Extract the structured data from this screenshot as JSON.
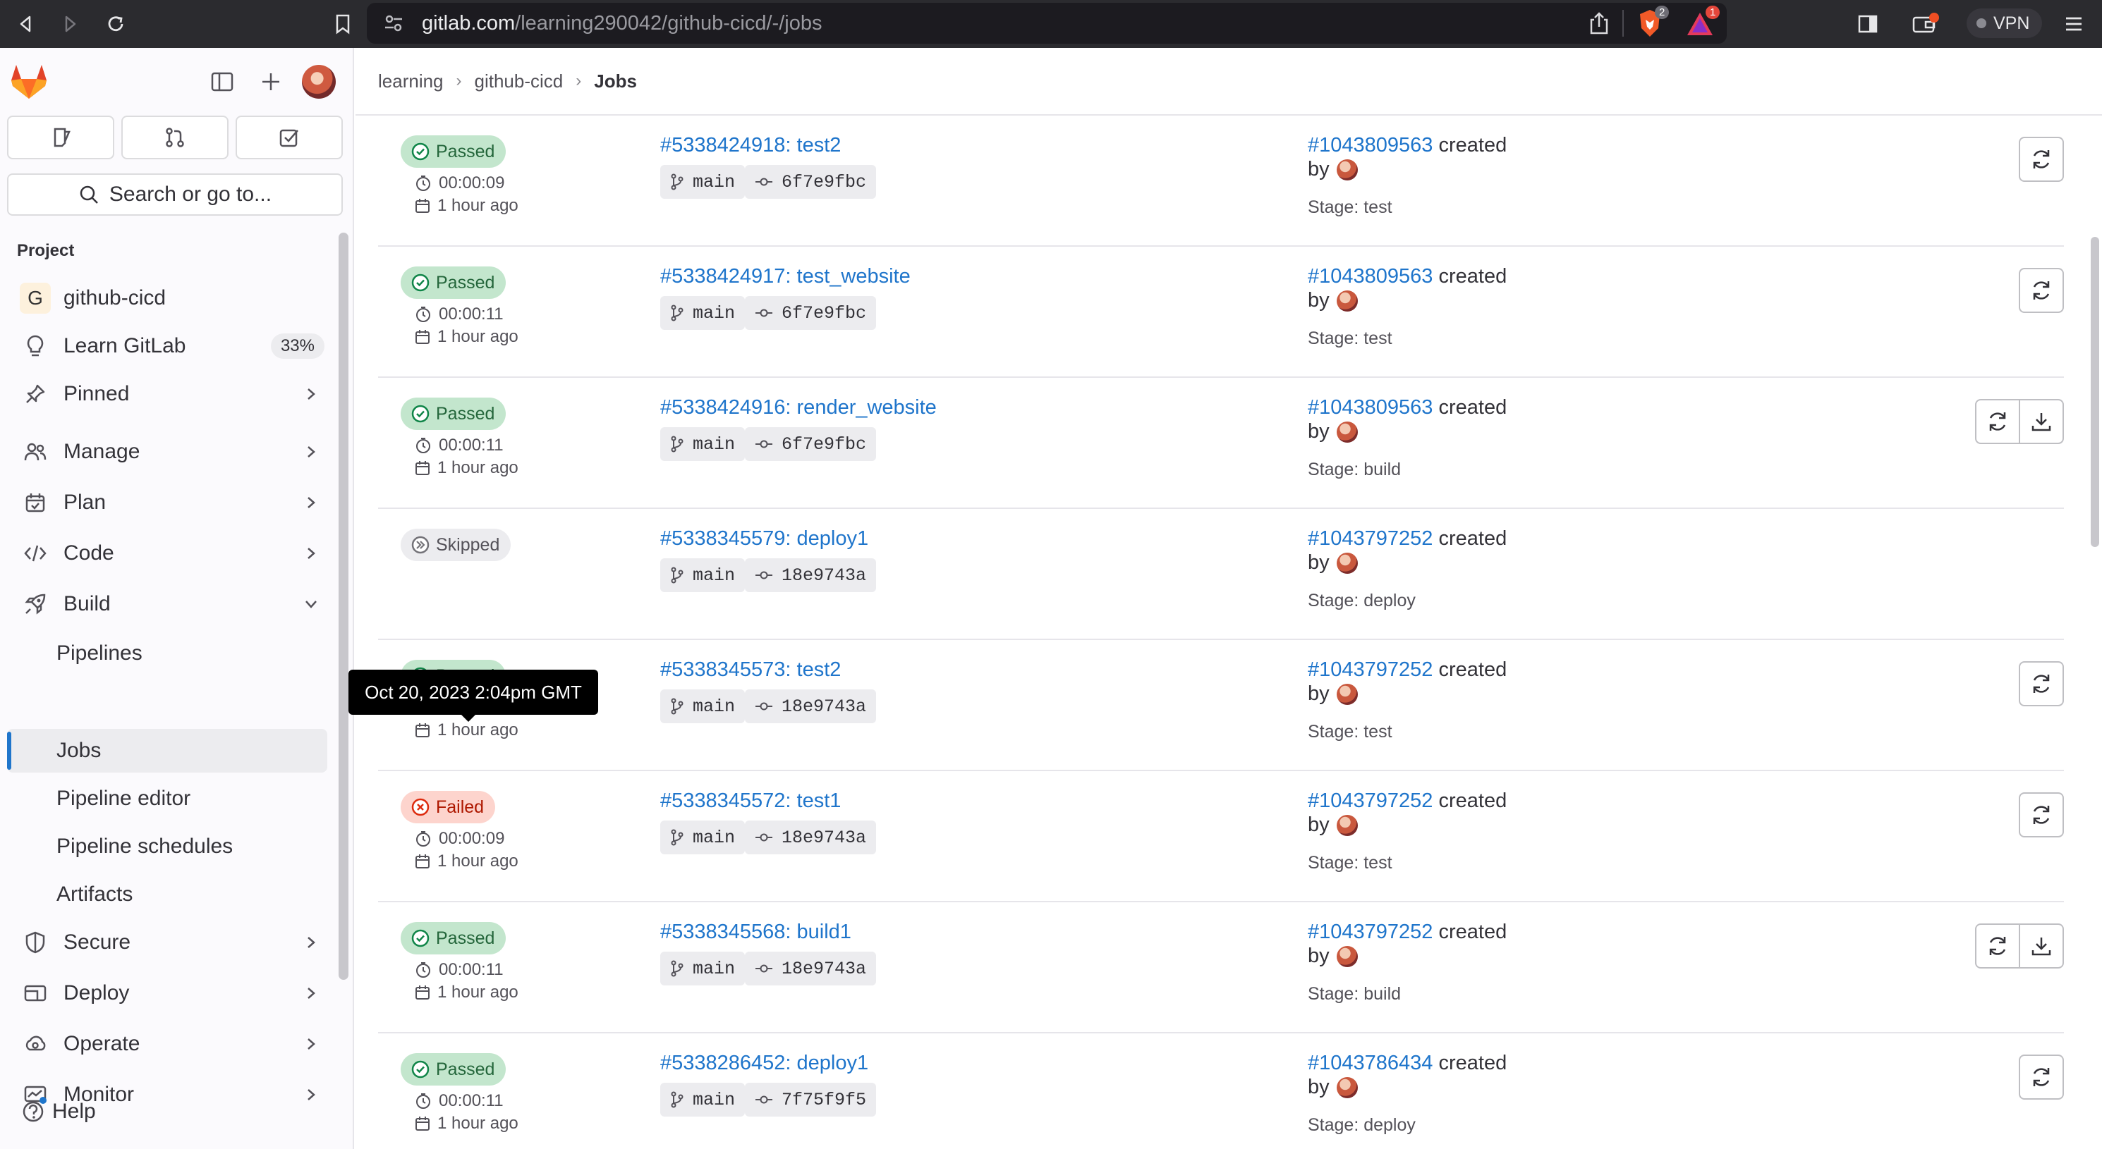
{
  "browser": {
    "url_host": "gitlab.com",
    "url_path": "/learning290042/github-cicd/-/jobs",
    "brave_badge": "2",
    "alert_badge": "1",
    "vpn_label": "VPN"
  },
  "sidebar": {
    "search_label": "Search or go to...",
    "section_title": "Project",
    "project_name": "github-cicd",
    "project_initial": "G",
    "items": [
      {
        "label": "Learn GitLab",
        "badge": "33%"
      },
      {
        "label": "Pinned"
      },
      {
        "label": "Manage"
      },
      {
        "label": "Plan"
      },
      {
        "label": "Code"
      },
      {
        "label": "Build"
      },
      {
        "label": "Secure"
      },
      {
        "label": "Deploy"
      },
      {
        "label": "Operate"
      },
      {
        "label": "Monitor"
      }
    ],
    "build_subitems": [
      "Pipelines",
      "Jobs",
      "Pipeline editor",
      "Pipeline schedules",
      "Artifacts"
    ],
    "help_label": "Help"
  },
  "breadcrumb": [
    "learning",
    "github-cicd",
    "Jobs"
  ],
  "jobs": [
    {
      "status": "Passed",
      "duration": "00:00:09",
      "time": "1 hour ago",
      "job": "#5338424918: test2",
      "ref": "main",
      "sha": "6f7e9fbc",
      "pipeline": "#1043809563",
      "created": "created",
      "by": "by",
      "stage": "Stage: test"
    },
    {
      "status": "Passed",
      "duration": "00:00:11",
      "time": "1 hour ago",
      "job": "#5338424917: test_website",
      "ref": "main",
      "sha": "6f7e9fbc",
      "pipeline": "#1043809563",
      "created": "created",
      "by": "by",
      "stage": "Stage: test"
    },
    {
      "status": "Passed",
      "duration": "00:00:11",
      "time": "1 hour ago",
      "job": "#5338424916: render_website",
      "ref": "main",
      "sha": "6f7e9fbc",
      "pipeline": "#1043809563",
      "created": "created",
      "by": "by",
      "stage": "Stage: build"
    },
    {
      "status": "Skipped",
      "job": "#5338345579: deploy1",
      "ref": "main",
      "sha": "18e9743a",
      "pipeline": "#1043797252",
      "created": "created",
      "by": "by",
      "stage": "Stage: deploy"
    },
    {
      "status": "Passed",
      "time": "1 hour ago",
      "job": "#5338345573: test2",
      "ref": "main",
      "sha": "18e9743a",
      "pipeline": "#1043797252",
      "created": "created",
      "by": "by",
      "stage": "Stage: test"
    },
    {
      "status": "Failed",
      "duration": "00:00:09",
      "time": "1 hour ago",
      "job": "#5338345572: test1",
      "ref": "main",
      "sha": "18e9743a",
      "pipeline": "#1043797252",
      "created": "created",
      "by": "by",
      "stage": "Stage: test"
    },
    {
      "status": "Passed",
      "duration": "00:00:11",
      "time": "1 hour ago",
      "job": "#5338345568: build1",
      "ref": "main",
      "sha": "18e9743a",
      "pipeline": "#1043797252",
      "created": "created",
      "by": "by",
      "stage": "Stage: build"
    },
    {
      "status": "Passed",
      "duration": "00:00:11",
      "time": "1 hour ago",
      "job": "#5338286452: deploy1",
      "ref": "main",
      "sha": "7f75f9f5",
      "pipeline": "#1043786434",
      "created": "created",
      "by": "by",
      "stage": "Stage: deploy"
    }
  ],
  "tooltip": "Oct 20, 2023 2:04pm GMT",
  "colors": {
    "link": "#1f75cb",
    "passed": "#108548",
    "failed": "#dd2b0e"
  }
}
